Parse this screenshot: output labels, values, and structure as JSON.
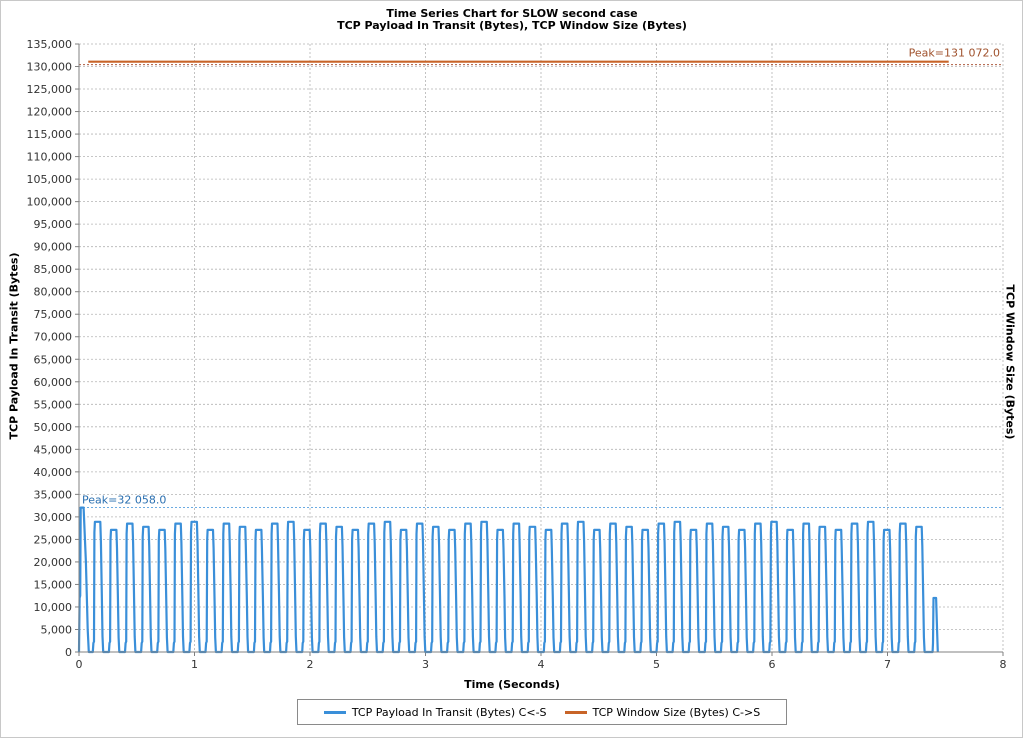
{
  "chart_data": {
    "type": "line",
    "title": "Time Series Chart for SLOW second case",
    "subtitle": "TCP Payload In Transit (Bytes), TCP Window Size (Bytes)",
    "xlabel": "Time (Seconds)",
    "ylabel_left": "TCP Payload In Transit (Bytes)",
    "ylabel_right": "TCP Window Size (Bytes)",
    "xlim": [
      0,
      8
    ],
    "ylim": [
      0,
      135000
    ],
    "x_ticks": [
      "0",
      "1",
      "2",
      "3",
      "4",
      "5",
      "6",
      "7",
      "8"
    ],
    "y_ticks": [
      "0",
      "5,000",
      "10,000",
      "15,000",
      "20,000",
      "25,000",
      "30,000",
      "35,000",
      "40,000",
      "45,000",
      "50,000",
      "55,000",
      "60,000",
      "65,000",
      "70,000",
      "75,000",
      "80,000",
      "85,000",
      "90,000",
      "95,000",
      "100,000",
      "105,000",
      "110,000",
      "115,000",
      "120,000",
      "125,000",
      "130,000",
      "135,000"
    ],
    "grid": true,
    "legend_position": "bottom",
    "series": [
      {
        "name": "TCP Payload In Transit (Bytes) C<-S",
        "color": "#3a8fd9",
        "peak_label": "Peak=32 058.0",
        "peak_value": 32058,
        "x_range": [
          0.0,
          7.53
        ],
        "typical_burst_peak": 28500,
        "burst_count": 54,
        "final_burst_peak": 12000
      },
      {
        "name": "TCP Window Size (Bytes) C->S",
        "color": "#c86428",
        "peak_label": "Peak=131 072.0",
        "peak_value": 131072,
        "x": [
          0.08,
          7.53
        ],
        "y": [
          131072,
          131072
        ]
      }
    ]
  }
}
